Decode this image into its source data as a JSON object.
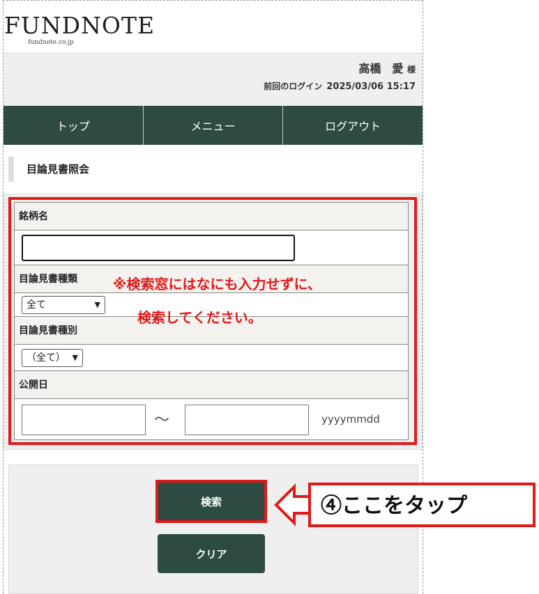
{
  "header": {
    "logo": "FUNDNOTE",
    "logo_sub": "fundnote.co.jp",
    "user_name": "高橋　愛",
    "user_suffix": "様",
    "last_login_label": "前回のログイン",
    "last_login_value": "2025/03/06 15:17"
  },
  "nav": {
    "items": [
      "トップ",
      "メニュー",
      "ログアウト"
    ]
  },
  "page": {
    "title": "目論見書照会"
  },
  "form": {
    "brand_label": "銘柄名",
    "brand_value": "",
    "doc_type_label": "目論見書種類",
    "doc_type_value": "全て",
    "doc_kind_label": "目論見書種別",
    "doc_kind_value": "（全て）",
    "publish_date_label": "公開日",
    "date_from": "",
    "date_separator": "～",
    "date_to": "",
    "date_format": "yyyymmdd"
  },
  "annotation": {
    "note_line1": "※検索窓にはなにも入力せずに、",
    "note_line2": "検索してください。",
    "callout": "④ここをタップ",
    "accent_color": "#e01919"
  },
  "buttons": {
    "search": "検索",
    "clear": "クリア"
  }
}
